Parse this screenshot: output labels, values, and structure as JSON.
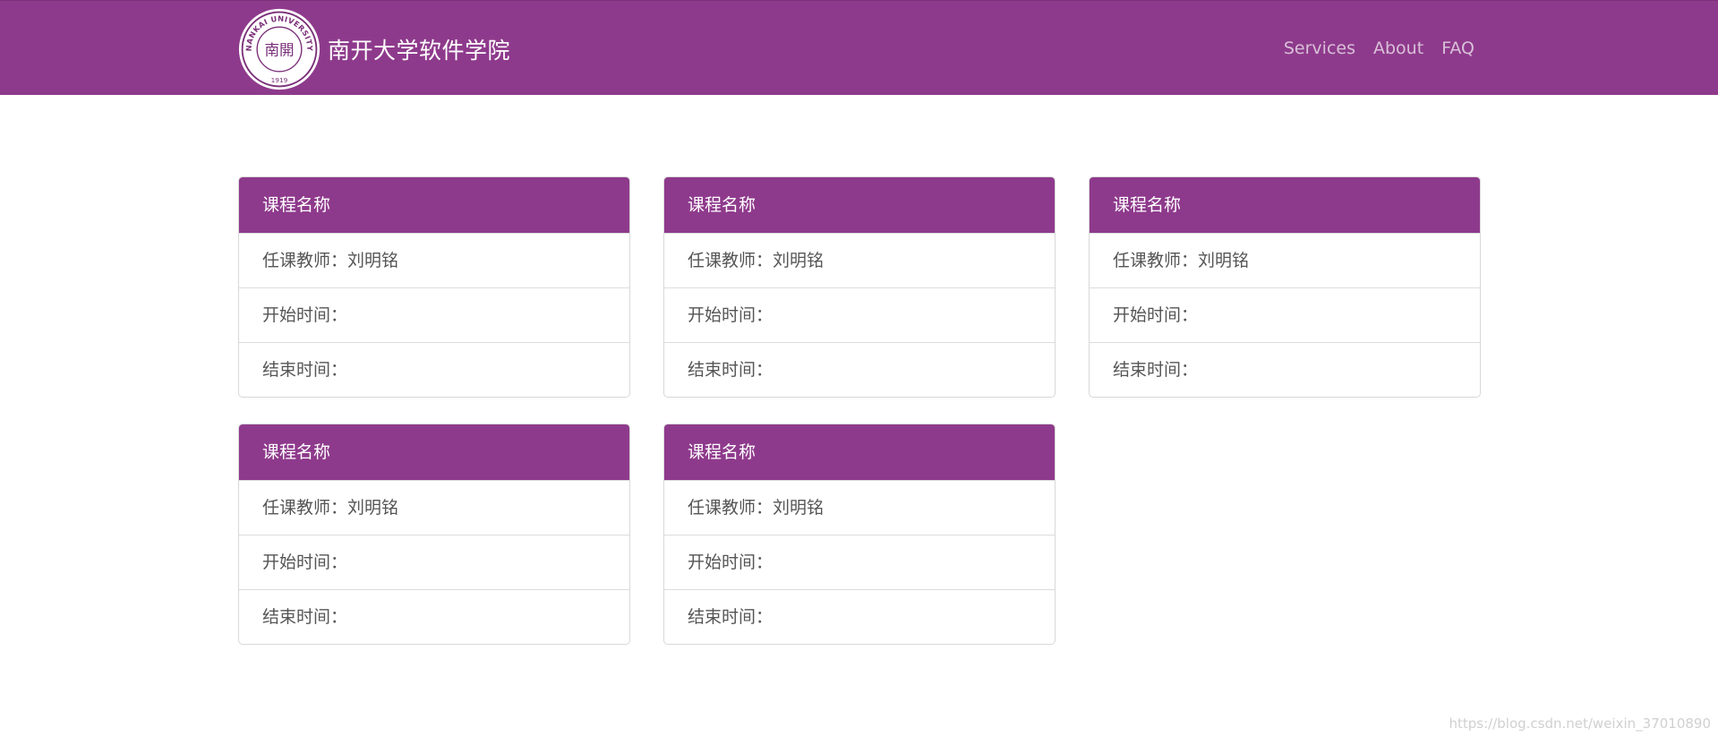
{
  "header": {
    "brand_name": "南开大学软件学院",
    "logo": {
      "top_text": "NANKAI UNIVERSITY",
      "center_text": "南開",
      "year": "1919"
    },
    "nav_links": [
      {
        "label": "Services"
      },
      {
        "label": "About"
      },
      {
        "label": "FAQ"
      }
    ]
  },
  "courses": [
    {
      "title": "课程名称",
      "teacher": "任课教师：刘明铭",
      "start": "开始时间：",
      "end": "结束时间："
    },
    {
      "title": "课程名称",
      "teacher": "任课教师：刘明铭",
      "start": "开始时间：",
      "end": "结束时间："
    },
    {
      "title": "课程名称",
      "teacher": "任课教师：刘明铭",
      "start": "开始时间：",
      "end": "结束时间："
    },
    {
      "title": "课程名称",
      "teacher": "任课教师：刘明铭",
      "start": "开始时间：",
      "end": "结束时间："
    },
    {
      "title": "课程名称",
      "teacher": "任课教师：刘明铭",
      "start": "开始时间：",
      "end": "结束时间："
    }
  ],
  "watermark": "https://blog.csdn.net/weixin_37010890",
  "colors": {
    "brand_purple": "#8e3a8c",
    "nav_link": "#d9c0d8",
    "text_gray": "#555555"
  }
}
